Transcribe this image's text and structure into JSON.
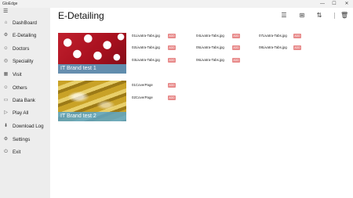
{
  "app": {
    "title": "GloEdge",
    "window_controls": [
      "—",
      "☐",
      "✕"
    ]
  },
  "sidebar": {
    "menu_icon": "hamburger-icon",
    "items": [
      {
        "label": "DashBoard",
        "icon": "home-icon",
        "glyph": "⌂"
      },
      {
        "label": "E-Detailing",
        "icon": "gear-icon",
        "glyph": "⚙"
      },
      {
        "label": "Doctors",
        "icon": "user-icon",
        "glyph": "☺"
      },
      {
        "label": "Speciality",
        "icon": "target-icon",
        "glyph": "◎"
      },
      {
        "label": "Visit",
        "icon": "calendar-icon",
        "glyph": "▦"
      },
      {
        "label": "Others",
        "icon": "user-group-icon",
        "glyph": "☺"
      },
      {
        "label": "Data Bank",
        "icon": "folder-icon",
        "glyph": "▭"
      },
      {
        "label": "Play All",
        "icon": "play-icon",
        "glyph": "▷"
      },
      {
        "label": "Download Log",
        "icon": "download-icon",
        "glyph": "⬇"
      },
      {
        "label": "Settings",
        "icon": "settings-icon",
        "glyph": "⚙"
      },
      {
        "label": "Exit",
        "icon": "power-icon",
        "glyph": "⏻"
      }
    ]
  },
  "main": {
    "title": "E-Detailing",
    "toolbar": [
      {
        "name": "list-view-icon",
        "glyph": "☰"
      },
      {
        "name": "grid-view-icon",
        "glyph": "⊞"
      },
      {
        "name": "sort-icon",
        "glyph": "⇅"
      },
      {
        "name": "delete-icon",
        "glyph": "🗑"
      }
    ],
    "brands": [
      {
        "label": "IT Brand test 1",
        "files": [
          {
            "name": "01Livatra-Tabs.jpg",
            "badge": "ADD"
          },
          {
            "name": "02Livatra-Tabs.jpg",
            "badge": "ADD"
          },
          {
            "name": "03Livatra-Tabs.jpg",
            "badge": "ADD"
          },
          {
            "name": "04Livatra-Tabs.jpg",
            "badge": "ADD"
          },
          {
            "name": "05Livatra-Tabs.jpg",
            "badge": "ADD"
          },
          {
            "name": "06Livatra-Tabs.jpg",
            "badge": "ADD"
          },
          {
            "name": "07Livatra-Tabs.jpg",
            "badge": "ADD"
          },
          {
            "name": "08Livatra-Tabs.jpg",
            "badge": "ADD"
          }
        ]
      },
      {
        "label": "IT Brand test 2",
        "files": [
          {
            "name": "01CoverPage",
            "badge": "ADD"
          },
          {
            "name": "02CoverPage",
            "badge": "ADD"
          }
        ]
      }
    ]
  }
}
